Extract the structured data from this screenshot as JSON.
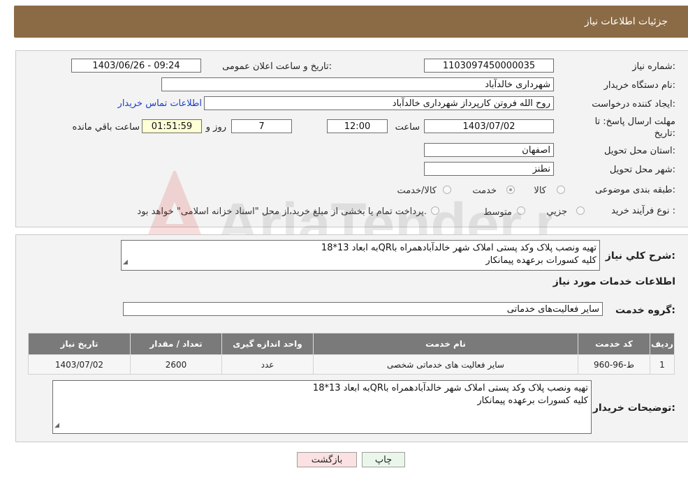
{
  "header": {
    "title": "جزئیات اطلاعات نیاز"
  },
  "form": {
    "need_number_label": "شماره نیاز:",
    "need_number": "1103097450000035",
    "announce_label": "تاریخ و ساعت اعلان عمومی:",
    "announce_value": "1403/06/26 - 09:24",
    "buyer_org_label": "نام دستگاه خریدار:",
    "buyer_org": "شهرداری خالدآباد",
    "creator_label": "ایجاد کننده درخواست:",
    "creator": "روح الله فروتن کارپرداز شهرداری خالدآباد",
    "contact_link": "اطلاعات تماس خریدار",
    "deadline_label_1": "مهلت ارسال پاسخ: تا",
    "deadline_label_2": "تاریخ:",
    "deadline_date": "1403/07/02",
    "time_label": "ساعت",
    "deadline_time": "12:00",
    "days_value": "7",
    "days_label": "روز و",
    "remaining_time": "01:51:59",
    "remaining_label": "ساعت باقي مانده",
    "province_label": "استان محل تحویل:",
    "province": "اصفهان",
    "city_label": "شهر محل تحویل:",
    "city": "نطنز",
    "category_label": "طبقه بندی موضوعی:",
    "category_options": [
      "کالا",
      "خدمت",
      "کالا/خدمت"
    ],
    "process_label": "نوع فرآیند خرید :",
    "process_options": [
      "جزیي",
      "متوسط"
    ],
    "payment_note": "پرداخت تمام یا بخشی از مبلغ خرید،از محل \"اسناد خزانه اسلامی\" خواهد بود."
  },
  "details": {
    "summary_label": "شرح کلي نياز:",
    "summary_line1": "تهیه ونصب پلاک وکد پستی املاک شهر خالدآبادهمراه باQRبه ابعاد 13*18",
    "summary_line2": "کلیه کسورات برعهده پیمانکار",
    "services_heading": "اطلاعات خدمات مورد نیاز",
    "service_group_label": "گروه خدمت:",
    "service_group": "سایر فعالیت‌های خدماتی",
    "table": {
      "headers": [
        "ردیف",
        "کد خدمت",
        "نام خدمت",
        "واحد اندازه گیری",
        "تعداد / مقدار",
        "تاریخ نیاز"
      ],
      "rows": [
        [
          "1",
          "ط-96-960",
          "سایر فعالیت های خدماتی شخصی",
          "عدد",
          "2600",
          "1403/07/02"
        ]
      ]
    },
    "buyer_notes_label": "توضیحات خریدار:",
    "buyer_notes_line1": "تهیه ونصب پلاک وکد پستی املاک شهر خالدآبادهمراه باQRبه ابعاد 13*18",
    "buyer_notes_line2": "کلیه کسورات برعهده پیمانکار"
  },
  "buttons": {
    "print": "چاپ",
    "back": "بازگشت"
  },
  "watermark": "AriaTender.net",
  "colors": {
    "header_bg": "#8b6b45",
    "table_header_bg": "#7a7a7a",
    "link": "#1a3fc9",
    "back_button_bg": "#fbe1e1",
    "print_button_bg": "#eaf6ea"
  }
}
